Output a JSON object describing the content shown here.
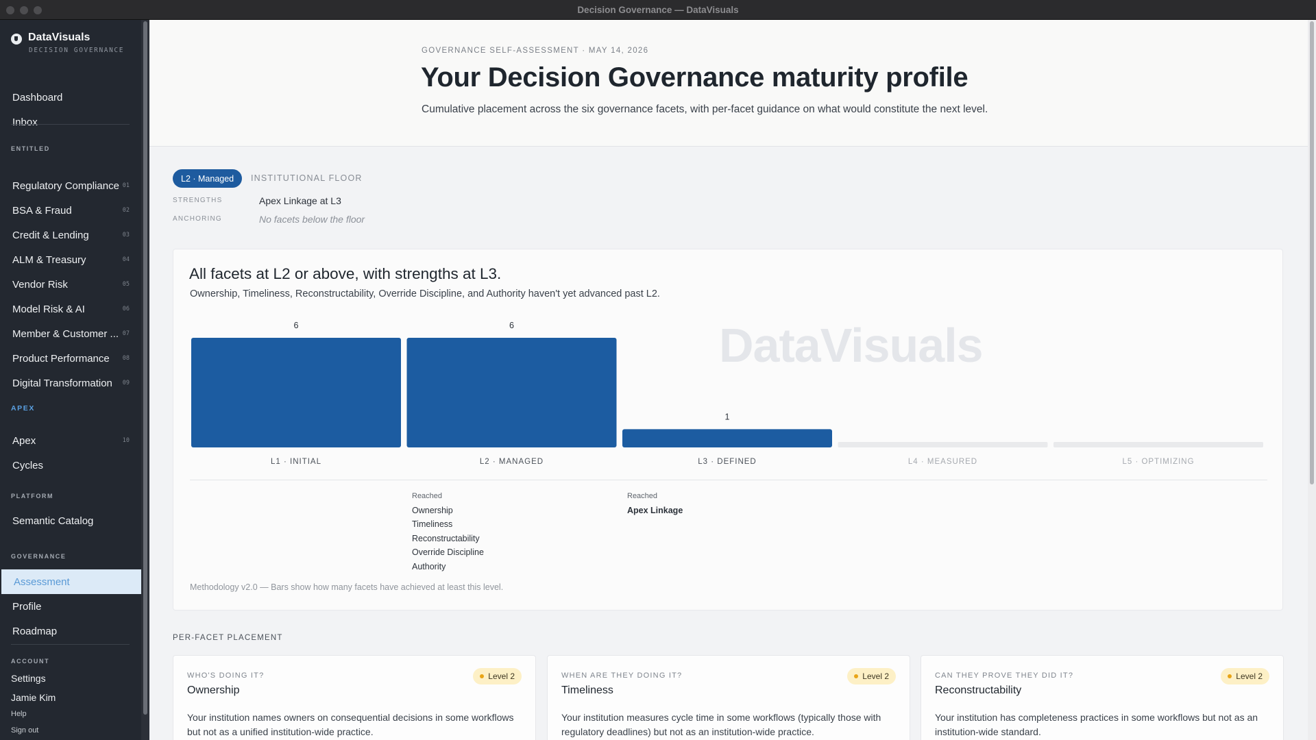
{
  "window": {
    "title": "Decision Governance — DataVisuals"
  },
  "brand": {
    "name": "DataVisuals",
    "subtitle": "DECISION GOVERNANCE"
  },
  "sidebar": {
    "top": [
      {
        "label": "Dashboard"
      },
      {
        "label": "Inbox"
      }
    ],
    "entitled_label": "ENTITLED",
    "entitled": [
      {
        "label": "Regulatory Compliance",
        "num": "01"
      },
      {
        "label": "BSA & Fraud",
        "num": "02"
      },
      {
        "label": "Credit & Lending",
        "num": "03"
      },
      {
        "label": "ALM & Treasury",
        "num": "04"
      },
      {
        "label": "Vendor Risk",
        "num": "05"
      },
      {
        "label": "Model Risk & AI",
        "num": "06"
      },
      {
        "label": "Member & Customer ...",
        "num": "07"
      },
      {
        "label": "Product Performance",
        "num": "08"
      },
      {
        "label": "Digital Transformation",
        "num": "09"
      }
    ],
    "apex_label": "APEX",
    "apex": [
      {
        "label": "Apex",
        "num": "10"
      },
      {
        "label": "Cycles"
      }
    ],
    "platform_label": "PLATFORM",
    "platform": [
      {
        "label": "Semantic Catalog"
      }
    ],
    "governance_label": "GOVERNANCE",
    "governance": [
      {
        "label": "Assessment",
        "active": true
      },
      {
        "label": "Profile"
      },
      {
        "label": "Roadmap"
      }
    ],
    "account_label": "ACCOUNT",
    "account": {
      "settings": "Settings",
      "user": "Jamie Kim",
      "help": "Help",
      "signout": "Sign out"
    }
  },
  "hero": {
    "eyebrow": "GOVERNANCE SELF-ASSESSMENT · MAY 14, 2026",
    "title": "Your Decision Governance maturity profile",
    "lede": "Cumulative placement across the six governance facets, with per-facet guidance on what would constitute the next level."
  },
  "placement": {
    "badge": "L2 · Managed",
    "floor_label": "INSTITUTIONAL FLOOR",
    "strengths_key": "STRENGTHS",
    "strengths_value": "Apex Linkage at L3",
    "anchoring_key": "ANCHORING",
    "anchoring_value": "No facets below the floor"
  },
  "summary_card": {
    "headline": "All facets at L2 or above, with strengths at L3.",
    "summary": "Ownership, Timeliness, Reconstructability, Override Discipline, and Authority haven't yet advanced past L2.",
    "watermark": "DataVisuals",
    "reached_label": "Reached",
    "reached_l2": [
      "Ownership",
      "Timeliness",
      "Reconstructability",
      "Override Discipline",
      "Authority"
    ],
    "reached_l3": [
      "Apex Linkage"
    ],
    "methodology": "Methodology v2.0 — Bars show how many facets have achieved at least this level."
  },
  "chart_data": {
    "type": "bar",
    "categories": [
      "L1 · INITIAL",
      "L2 · MANAGED",
      "L3 · DEFINED",
      "L4 · MEASURED",
      "L5 · OPTIMIZING"
    ],
    "values": [
      6,
      6,
      1,
      0,
      0
    ],
    "ylim": [
      0,
      6
    ],
    "grid": false,
    "bar_color": "#1c5ca1",
    "empty_color": "#e9eaec"
  },
  "per_facet": {
    "label": "PER-FACET PLACEMENT",
    "cards": [
      {
        "question": "WHO'S DOING IT?",
        "name": "Ownership",
        "level": "Level 2",
        "desc": "Your institution names owners on consequential decisions in some workflows but not as a unified institution-wide practice."
      },
      {
        "question": "WHEN ARE THEY DOING IT?",
        "name": "Timeliness",
        "level": "Level 2",
        "desc": "Your institution measures cycle time in some workflows (typically those with regulatory deadlines) but not as an institution-wide practice."
      },
      {
        "question": "CAN THEY PROVE THEY DID IT?",
        "name": "Reconstructability",
        "level": "Level 2",
        "desc": "Your institution has completeness practices in some workflows but not as an institution-wide standard."
      }
    ]
  }
}
